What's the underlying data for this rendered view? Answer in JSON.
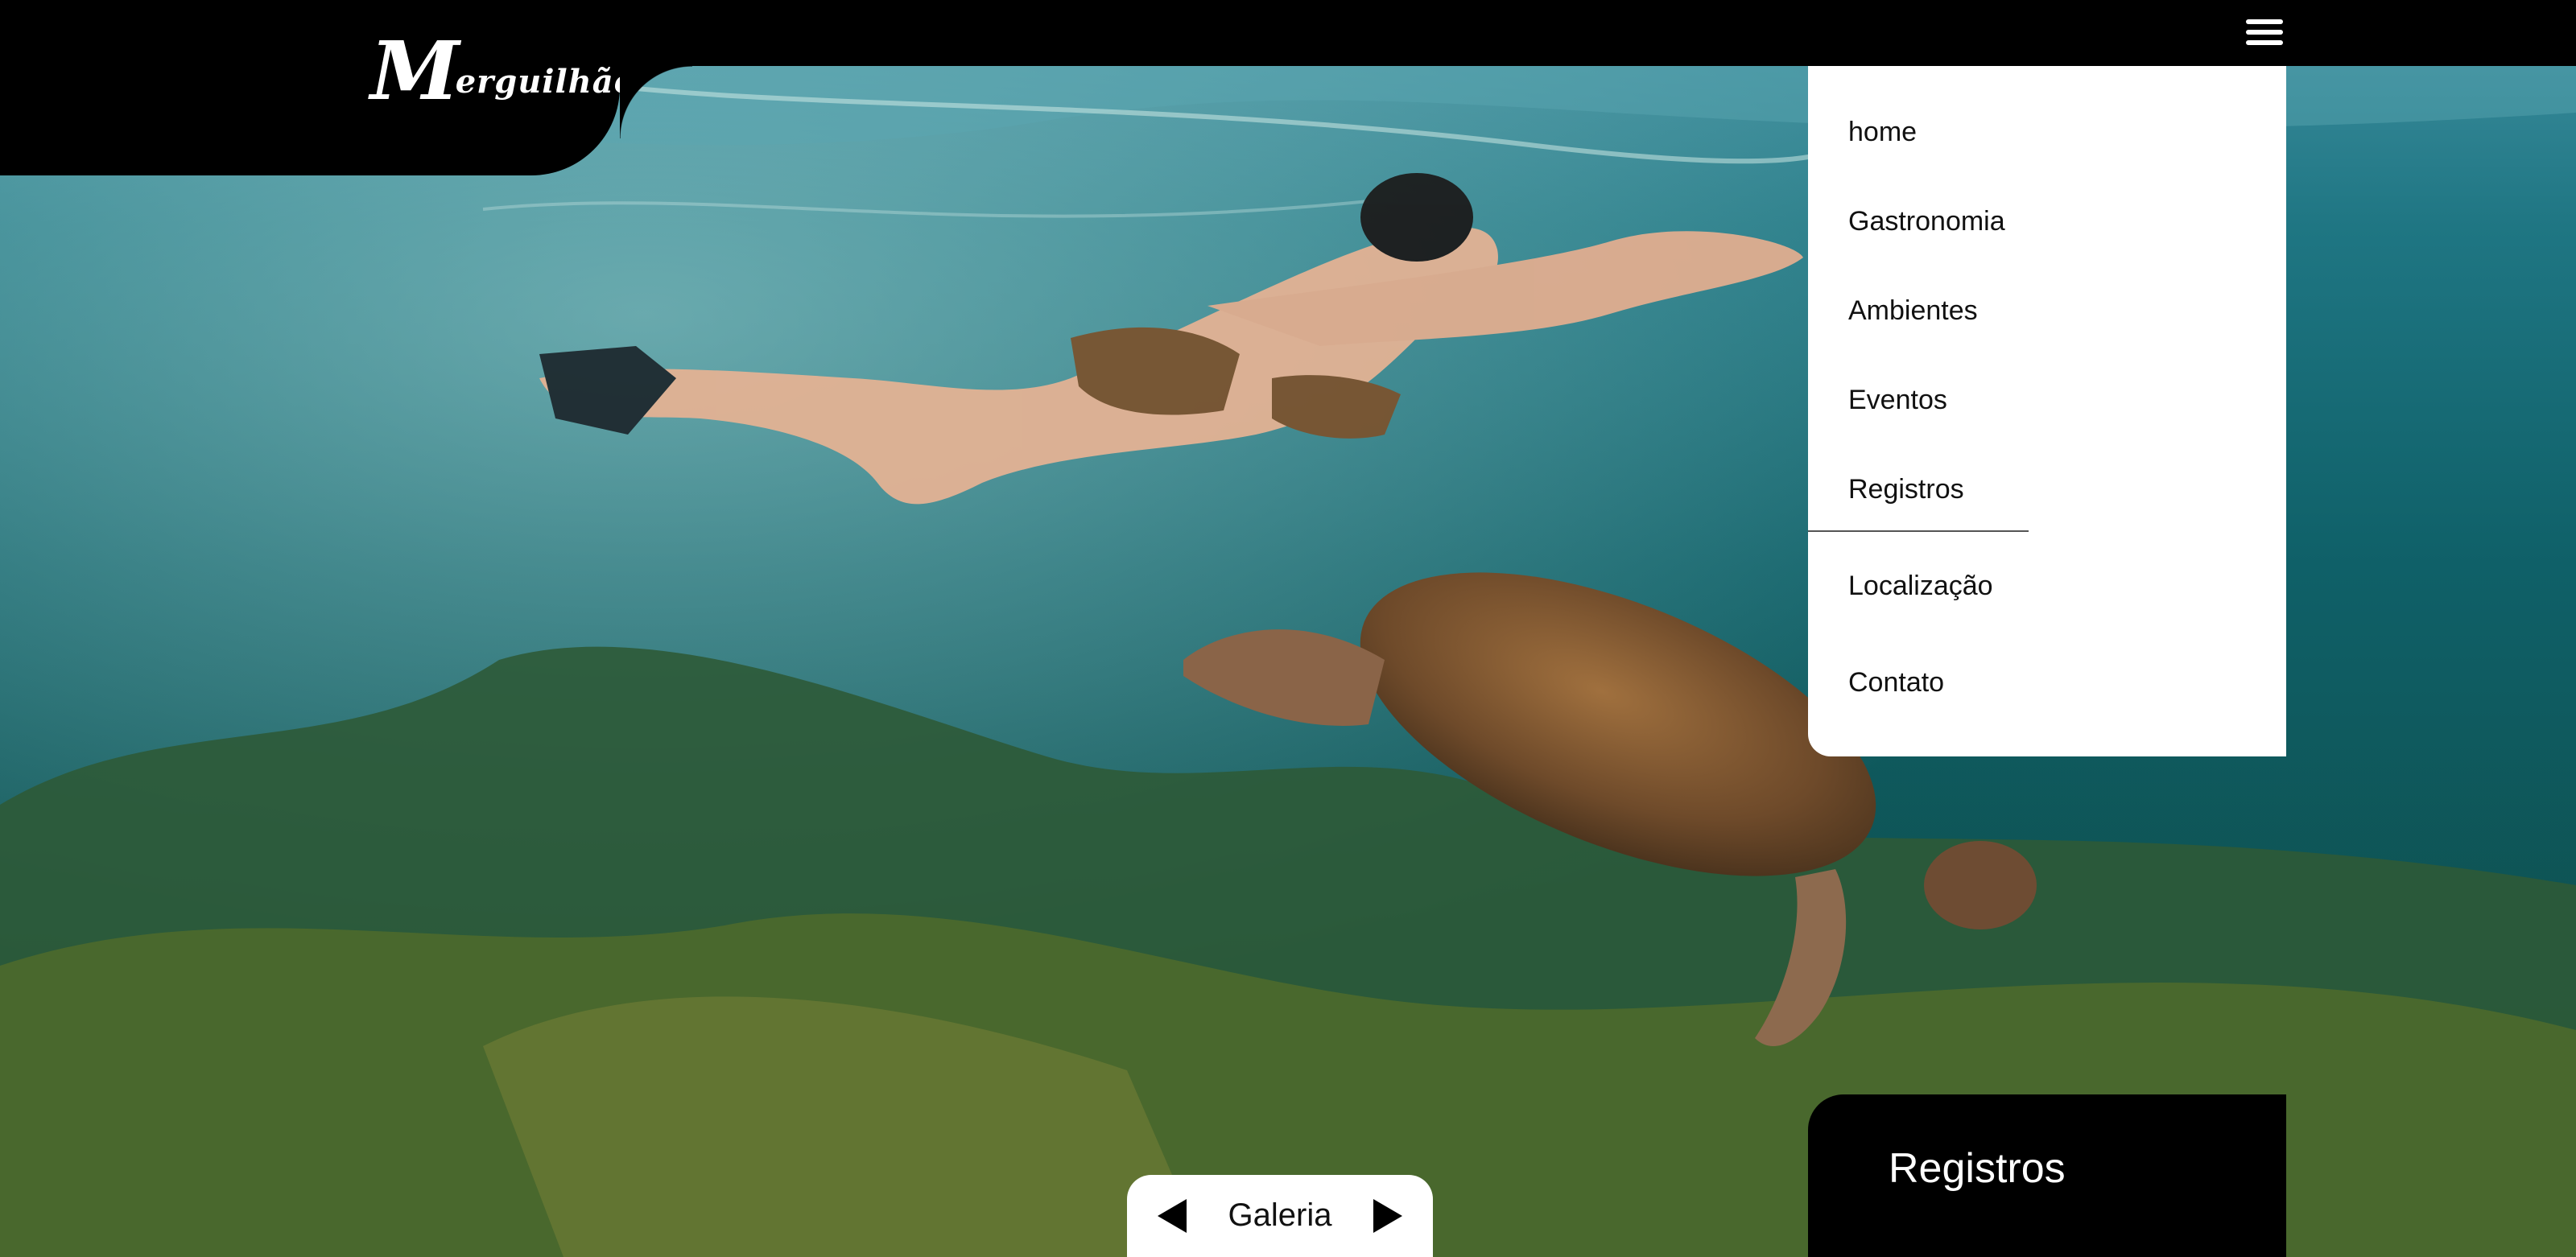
{
  "brand": {
    "logo_text": "erguilhão",
    "logo_initial": "M"
  },
  "header": {
    "menu_icon": "hamburger-icon"
  },
  "menu": {
    "items": [
      {
        "label": "home"
      },
      {
        "label": "Gastronomia"
      },
      {
        "label": "Ambientes"
      },
      {
        "label": "Eventos"
      },
      {
        "label": "Registros"
      },
      {
        "label": "Localização"
      },
      {
        "label": "Contato"
      }
    ],
    "active": "Registros"
  },
  "gallery": {
    "label": "Galeria",
    "prev_icon": "arrow-left-icon",
    "next_icon": "arrow-right-icon"
  },
  "section": {
    "title": "Registros"
  },
  "colors": {
    "bar": "#000000",
    "panel": "#ffffff",
    "water": "#0f5b66"
  }
}
